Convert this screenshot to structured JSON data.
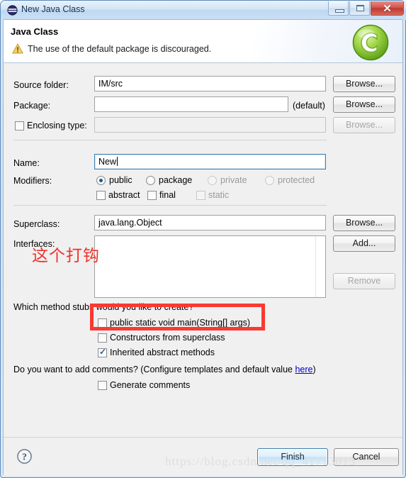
{
  "window": {
    "title": "New Java Class",
    "title_icon": "java-class-icon",
    "buttons": {
      "minimize": "minimize-icon",
      "maximize": "maximize-icon",
      "close": "✕"
    }
  },
  "header": {
    "title": "Java Class",
    "message": "The use of the default package is discouraged.",
    "warning_icon": "warning-triangle-icon",
    "banner_icon": "green-c-logo"
  },
  "form": {
    "source_folder": {
      "label": "Source folder:",
      "value": "IM/src",
      "browse_label": "Browse..."
    },
    "package": {
      "label": "Package:",
      "value": "",
      "suffix": "(default)",
      "browse_label": "Browse..."
    },
    "enclosing_type": {
      "label": "Enclosing type:",
      "value": "",
      "checked": false,
      "browse_label": "Browse..."
    },
    "name": {
      "label": "Name:",
      "value": "New"
    },
    "modifiers": {
      "label": "Modifiers:",
      "radios": [
        {
          "label": "public",
          "selected": true,
          "disabled": false
        },
        {
          "label": "package",
          "selected": false,
          "disabled": false
        },
        {
          "label": "private",
          "selected": false,
          "disabled": true
        },
        {
          "label": "protected",
          "selected": false,
          "disabled": true
        }
      ],
      "checks": [
        {
          "label": "abstract",
          "checked": false,
          "disabled": false
        },
        {
          "label": "final",
          "checked": false,
          "disabled": false
        },
        {
          "label": "static",
          "checked": false,
          "disabled": true
        }
      ]
    },
    "superclass": {
      "label": "Superclass:",
      "value": "java.lang.Object",
      "browse_label": "Browse..."
    },
    "interfaces": {
      "label": "Interfaces:",
      "items": [],
      "add_label": "Add...",
      "remove_label": "Remove"
    },
    "method_stubs": {
      "question": "Which method stubs would you like to create?",
      "options": [
        {
          "label": "public static void main(String[] args)",
          "checked": false
        },
        {
          "label": "Constructors from superclass",
          "checked": false
        },
        {
          "label": "Inherited abstract methods",
          "checked": true
        }
      ]
    },
    "comments": {
      "question_prefix": "Do you want to add comments? (Configure templates and default value ",
      "link_label": "here",
      "question_suffix": ")",
      "option": {
        "label": "Generate comments",
        "checked": false
      }
    }
  },
  "footer": {
    "help_icon": "help-question-icon",
    "finish_label": "Finish",
    "cancel_label": "Cancel"
  },
  "annotations": {
    "red_note": "这个打钩",
    "highlight_target": "public static void main(String[] args)",
    "watermark": "https://blog.csdn.net/qq_41713013"
  },
  "colors": {
    "accent": "#3c7fb1",
    "annotation_red": "#f93a32",
    "link": "#0000cc",
    "warning": "#f0b323"
  }
}
